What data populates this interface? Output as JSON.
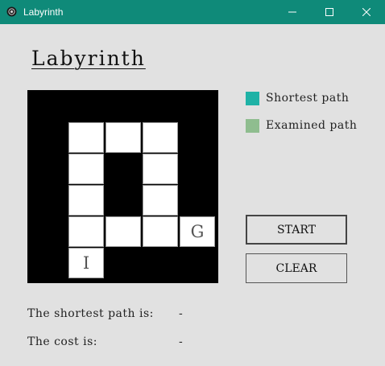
{
  "window": {
    "title": "Labyrinth"
  },
  "page": {
    "title": "Labyrinth"
  },
  "maze": {
    "rows": 5,
    "cols": 5,
    "cells": [
      {
        "row": 0,
        "col": 0,
        "label": ""
      },
      {
        "row": 0,
        "col": 1,
        "label": ""
      },
      {
        "row": 0,
        "col": 2,
        "label": ""
      },
      {
        "row": 1,
        "col": 0,
        "label": ""
      },
      {
        "row": 1,
        "col": 2,
        "label": ""
      },
      {
        "row": 2,
        "col": 0,
        "label": ""
      },
      {
        "row": 2,
        "col": 2,
        "label": ""
      },
      {
        "row": 3,
        "col": 0,
        "label": ""
      },
      {
        "row": 3,
        "col": 1,
        "label": ""
      },
      {
        "row": 3,
        "col": 2,
        "label": ""
      },
      {
        "row": 3,
        "col": 3,
        "label": "G"
      },
      {
        "row": 4,
        "col": 0,
        "label": "I"
      }
    ]
  },
  "legend": [
    {
      "label": "Shortest path",
      "color": "#1fb2a6"
    },
    {
      "label": "Examined path",
      "color": "#8fbd8f"
    }
  ],
  "buttons": {
    "start": "START",
    "clear": "CLEAR"
  },
  "results": {
    "shortest_label": "The shortest path is:",
    "shortest_value": "-",
    "cost_label": "The cost is:",
    "cost_value": "-"
  },
  "colors": {
    "titlebar": "#0f8a79",
    "background": "#e1e1e1"
  }
}
